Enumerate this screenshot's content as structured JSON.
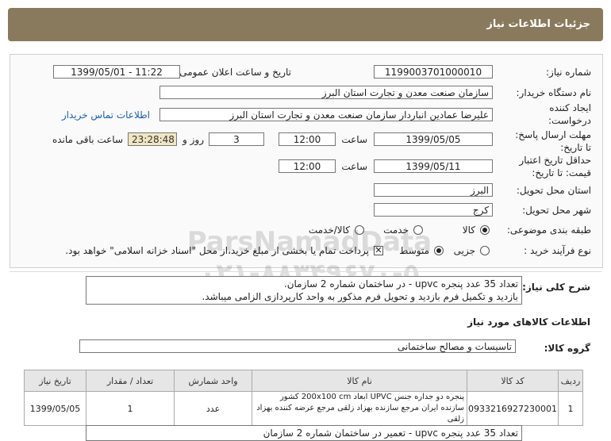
{
  "header": {
    "title": "جزئیات اطلاعات نیاز"
  },
  "form": {
    "need_number_label": "شماره نیاز:",
    "need_number": "1199003701000010",
    "announce_label": "تاریخ و ساعت اعلان عمومی:",
    "announce_value": "1399/05/01 - 11:22",
    "buyer_label": "نام دستگاه خریدار:",
    "buyer_value": "سازمان صنعت معدن و تجارت استان البرز",
    "creator_label_1": "ایجاد کننده",
    "creator_label_2": "درخواست:",
    "creator_value": "علیرضا عمادین انباردار سازمان صنعت معدن و تجارت استان البرز",
    "contact_link": "اطلاعات تماس خریدار",
    "deadline_label_1": "مهلت ارسال پاسخ:",
    "deadline_label_2": "تا تاریخ:",
    "deadline_date": "1399/05/05",
    "time_label": "ساعت",
    "deadline_time": "12:00",
    "days_value": "3",
    "days_label": "روز و",
    "remaining_time": "23:28:48",
    "remaining_label": "ساعت باقی مانده",
    "validity_label_1": "حداقل تاریخ اعتبار",
    "validity_label_2": "قیمت: تا تاریخ:",
    "validity_date": "1399/05/11",
    "validity_time_label": "ساعت",
    "validity_time": "12:00",
    "province_label": "استان محل تحویل:",
    "province_value": "البرز",
    "city_label": "شهر محل تحویل:",
    "city_value": "کرج",
    "category_label": "طبقه بندی موضوعی:",
    "category_goods": "کالا",
    "category_service": "خدمت",
    "category_both": "کالا/خدمت",
    "process_label": "نوع فرآیند خرید :",
    "process_partial": "جزیی",
    "process_medium": "متوسط",
    "payment_note": "پرداخت تمام یا بخشی از مبلغ خرید،از محل \"اسناد خزانه اسلامی\" خواهد بود."
  },
  "watermark": {
    "line1": "ParsNamadData",
    "line2": "۰۲۱-۸۸۳۴۹۶۷۰-۵"
  },
  "description": {
    "label": "شرح کلی نیاز:",
    "line1": "تعداد 35 عدد پنجره upvc -  در ساختمان شماره 2 سازمان.",
    "line2": "بازدید و تکمیل فرم بازدید و تحویل فرم مذکور به واحد کارپردازی الزامی میباشد."
  },
  "goods": {
    "section_title": "اطلاعات کالاهای مورد نیاز",
    "group_label": "گروه کالا:",
    "group_value": "تاسیسات و مصالح ساختمانی",
    "columns": [
      "ردیف",
      "کد کالا",
      "نام کالا",
      "واحد شمارش",
      "تعداد / مقدار",
      "تاریخ نیاز"
    ],
    "rows": [
      {
        "row": "1",
        "code": "0933216927230001",
        "name": "پنجره دو جداره جنس UPVC ابعاد 200x100 cm کشور سازنده ایران مرجع سازنده بهزاد زلقی مرجع عرضه کننده بهزاد زلقی",
        "unit": "عدد",
        "qty": "1",
        "date": "1399/05/05"
      }
    ]
  },
  "bottom": {
    "partial_text": "تعداد 35 عدد پنجره upvc - تعمیر در ساختمان شماره 2 سازمان"
  }
}
